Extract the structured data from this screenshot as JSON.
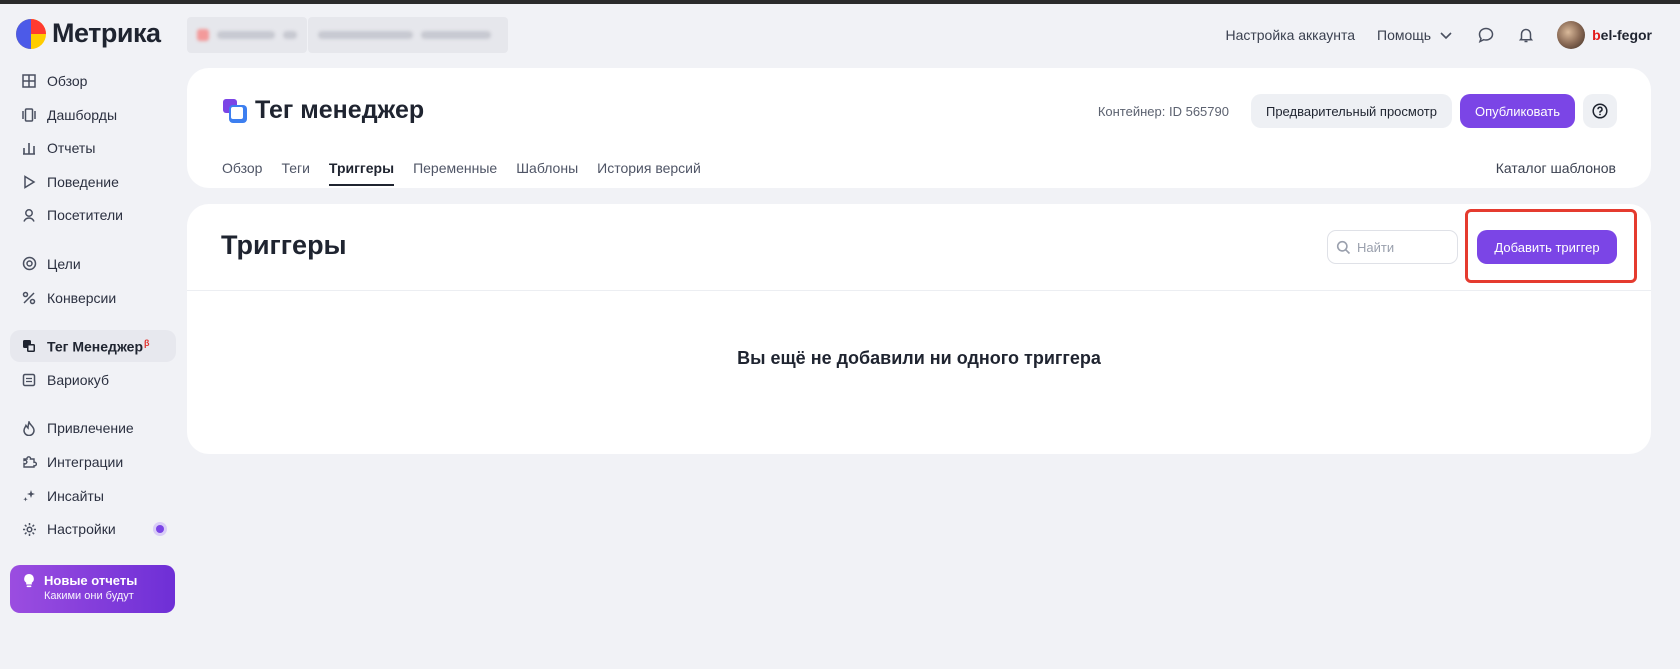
{
  "app": {
    "logo_text": "Метрика"
  },
  "header": {
    "account_settings": "Настройка аккаунта",
    "help": "Помощь",
    "username_first": "b",
    "username_rest": "el-fegor"
  },
  "sidebar": {
    "items": [
      {
        "label": "Обзор",
        "icon": "grid-icon"
      },
      {
        "label": "Дашборды",
        "icon": "dashboards-icon"
      },
      {
        "label": "Отчеты",
        "icon": "bar-chart-icon"
      },
      {
        "label": "Поведение",
        "icon": "play-icon"
      },
      {
        "label": "Посетители",
        "icon": "user-icon"
      },
      {
        "label": "Цели",
        "icon": "target-icon"
      },
      {
        "label": "Конверсии",
        "icon": "percent-icon"
      },
      {
        "label": "Тег Менеджер",
        "icon": "tag-manager-icon",
        "badge": "β"
      },
      {
        "label": "Вариокуб",
        "icon": "variocube-icon"
      },
      {
        "label": "Привлечение",
        "icon": "flame-icon"
      },
      {
        "label": "Интеграции",
        "icon": "puzzle-icon"
      },
      {
        "label": "Инсайты",
        "icon": "sparkle-icon"
      },
      {
        "label": "Настройки",
        "icon": "gear-icon"
      }
    ],
    "promo": {
      "title": "Новые отчеты",
      "subtitle": "Какими они будут"
    }
  },
  "tag_manager": {
    "title": "Тег менеджер",
    "container_id": "Контейнер: ID 565790",
    "preview_button": "Предварительный просмотр",
    "publish_button": "Опубликовать",
    "tabs": [
      "Обзор",
      "Теги",
      "Триггеры",
      "Переменные",
      "Шаблоны",
      "История версий"
    ],
    "active_tab": "Триггеры",
    "catalog_link": "Каталог шаблонов"
  },
  "triggers": {
    "title": "Триггеры",
    "search_placeholder": "Найти",
    "add_button": "Добавить триггер",
    "empty_message": "Вы ещё не добавили ни одного триггера"
  },
  "colors": {
    "accent": "#7b45e6",
    "highlight": "#e53b2f",
    "background": "#f1f2f6"
  }
}
